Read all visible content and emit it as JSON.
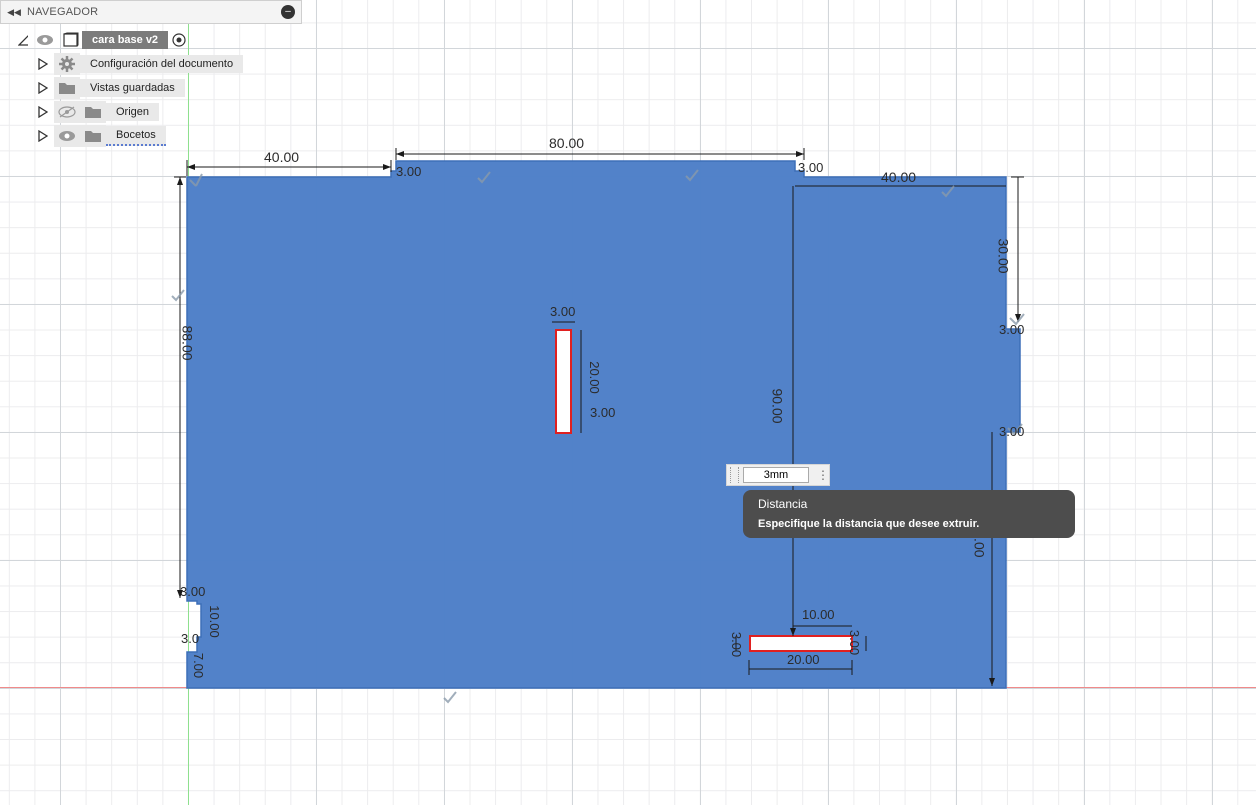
{
  "navigator": {
    "title": "NAVEGADOR",
    "root": {
      "label": "cara base v2"
    },
    "items": [
      {
        "label": "Configuración del documento",
        "icon": "gear-icon"
      },
      {
        "label": "Vistas guardadas",
        "icon": "folder-icon"
      },
      {
        "label": "Origen",
        "icon": "folder-icon",
        "visibility": "hidden-eye-icon"
      },
      {
        "label": "Bocetos",
        "icon": "folder-icon",
        "visibility": "eye-icon"
      }
    ]
  },
  "sketch": {
    "fill_color": "#4f80c8",
    "dimensions": {
      "top_left_width": "40.00",
      "top_center_width": "80.00",
      "top_right_width": "40.00",
      "left_height": "88.00",
      "center_height": "90.00",
      "right_top_height": "30.00",
      "right_bottom_height": "50.00",
      "top_notch": "3.00",
      "top_right_notch": "3.00",
      "right_notch_a": "3.00",
      "right_notch_b": "3.00",
      "left_notch_a": "3.00",
      "left_notch_b": "3.0",
      "left_notch_height": "10.00",
      "left_bottom": "7.00",
      "slot_width": "3.00",
      "slot_height": "20.00",
      "slot_offset": "3.00",
      "bottom_slot_offset": "10.00",
      "bottom_slot_width": "20.00",
      "bottom_slot_height": "3.00",
      "bottom_slot_right": "3.00"
    }
  },
  "distance_input": {
    "value": "3mm"
  },
  "tooltip": {
    "title": "Distancia",
    "description": "Especifique la distancia que desee extruir."
  },
  "colors": {
    "profile": "#4f80c8",
    "selection": "#e02020",
    "dimension": "#2b2b2b"
  }
}
